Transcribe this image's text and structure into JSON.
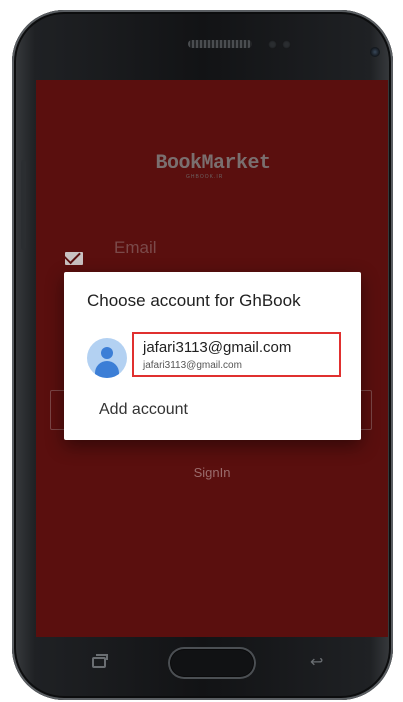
{
  "app": {
    "logo_text": "BookMarket",
    "logo_subtext": "GHBOOK.IR",
    "email_placeholder": "Email",
    "signin_label": "SignIn"
  },
  "dialog": {
    "title": "Choose account for GhBook",
    "account": {
      "primary": "jafari3113@gmail.com",
      "secondary": "jafari3113@gmail.com"
    },
    "add_account_label": "Add account"
  },
  "icons": {
    "email": "mail-icon",
    "avatar": "person-icon",
    "recents": "recents-icon",
    "home": "home-button",
    "back": "back-icon"
  },
  "colors": {
    "screen_background": "#5a0f0e",
    "highlight": "#e0302f",
    "avatar_blue": "#3c7ed6"
  }
}
